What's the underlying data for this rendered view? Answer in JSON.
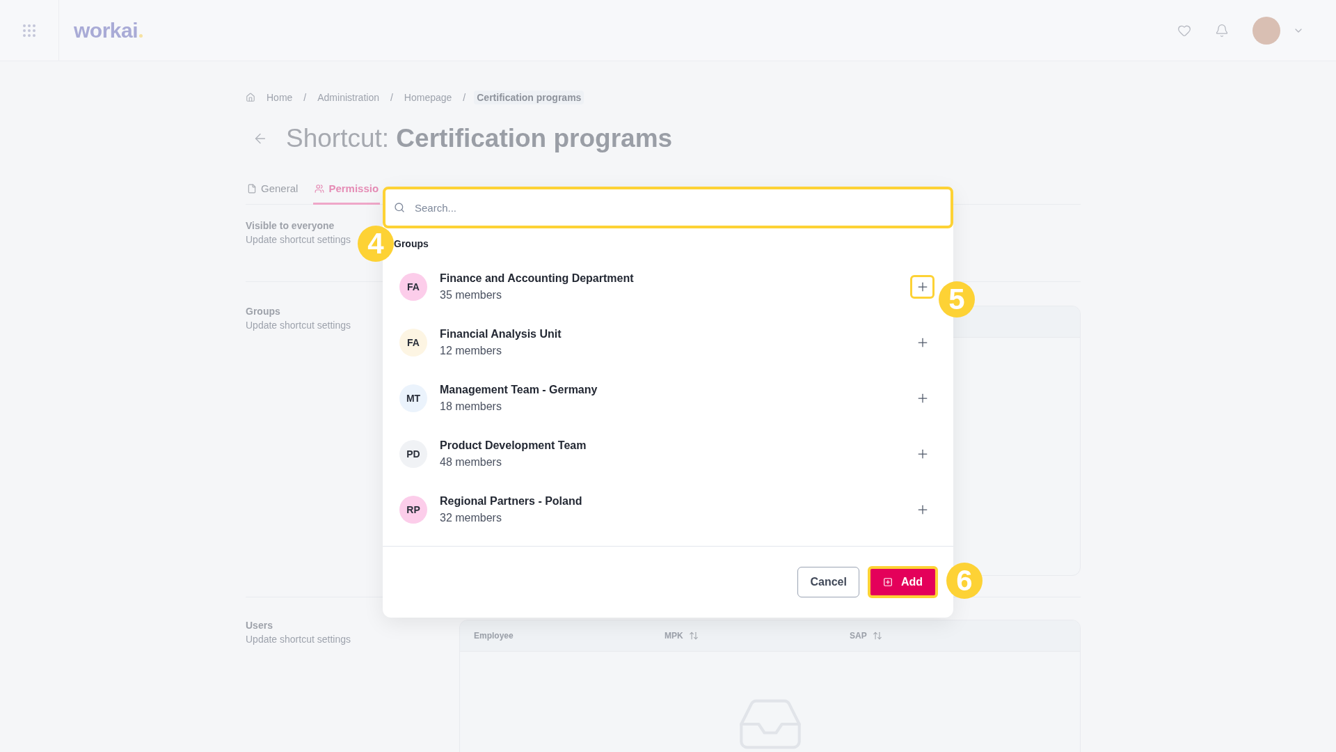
{
  "topbar": {
    "logo": "workai"
  },
  "breadcrumb": [
    {
      "label": "Home",
      "current": false
    },
    {
      "separator": "/",
      "label": "Administration",
      "current": false
    },
    {
      "separator": "/",
      "label": "Homepage",
      "current": false
    },
    {
      "separator": "/",
      "label": "Certification programs",
      "current": true
    }
  ],
  "title": {
    "prefix": "Shortcut:",
    "name": "Certification programs"
  },
  "tabs": [
    {
      "label": "General",
      "selected": false,
      "kind": "file"
    },
    {
      "label": "Permissio",
      "selected": true,
      "kind": "people"
    }
  ],
  "sections": [
    {
      "title": "Visible to everyone",
      "subtitle": "Update shortcut settings",
      "kind": "plain"
    },
    {
      "title": "Groups",
      "subtitle": "Update shortcut settings",
      "kind": "card"
    },
    {
      "title": "Users",
      "subtitle": "Update shortcut settings",
      "kind": "table",
      "columns": [
        {
          "label": "Employee",
          "sortable": false
        },
        {
          "label": "MPK",
          "sortable": true
        },
        {
          "label": "SAP",
          "sortable": true
        }
      ]
    }
  ],
  "modal": {
    "search": {
      "placeholder": "Search...",
      "highlighted": true
    },
    "group_heading": {
      "label": "Groups",
      "callout": "4"
    },
    "groups": [
      {
        "initials": "FA",
        "name": "Finance and Accounting Department",
        "members": "35 members",
        "color": "#fccdea",
        "highlighted": true,
        "callout": "5"
      },
      {
        "initials": "FA",
        "name": "Financial Analysis Unit",
        "members": "12 members",
        "color": "#fdf5e3",
        "highlighted": false
      },
      {
        "initials": "MT",
        "name": "Management Team - Germany",
        "members": "18 members",
        "color": "#ebf3fc",
        "highlighted": false
      },
      {
        "initials": "PD",
        "name": "Product Development Team",
        "members": "48 members",
        "color": "#f0f2f5",
        "highlighted": false
      },
      {
        "initials": "RP",
        "name": "Regional Partners - Poland",
        "members": "32 members",
        "color": "#fccdea",
        "highlighted": false
      }
    ],
    "cancel": "Cancel",
    "add": {
      "label": "Add",
      "highlighted": true,
      "callout": "6"
    }
  }
}
